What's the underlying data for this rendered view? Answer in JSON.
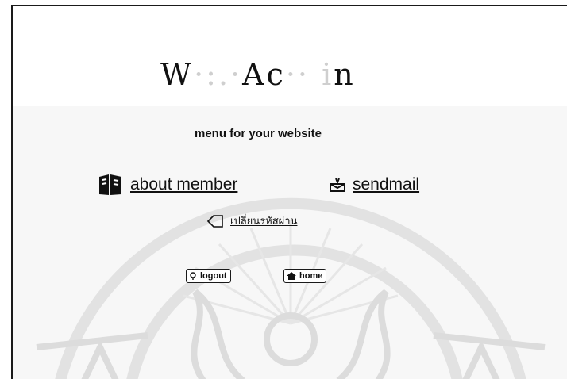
{
  "header": {
    "title_parts": [
      "W",
      "·:.·",
      "Ac",
      "·· i",
      "n"
    ]
  },
  "subtitle": "menu for your website",
  "nav": {
    "about_member": {
      "label": "about member",
      "icon": "book-icon"
    },
    "sendmail": {
      "label": "sendmail",
      "icon": "mail-icon"
    },
    "change_password": {
      "label": "เปลี่ยนรหัสผ่าน",
      "icon": "tag-icon"
    }
  },
  "buttons": {
    "logout": {
      "label": "logout",
      "icon": "key-icon"
    },
    "home": {
      "label": "home",
      "icon": "home-icon"
    }
  },
  "colors": {
    "text": "#111111",
    "watermark": "#e2e2e2",
    "band": "#f7f7f7"
  }
}
